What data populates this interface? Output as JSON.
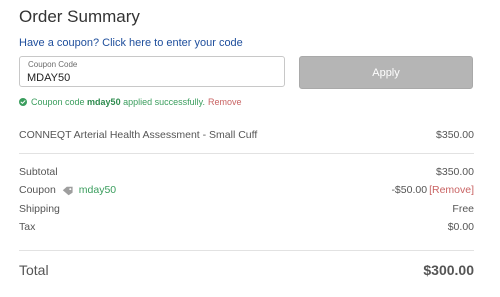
{
  "summary": {
    "title": "Order Summary",
    "coupon_link": "Have a coupon? Click here to enter your code"
  },
  "coupon_form": {
    "label": "Coupon Code",
    "value": "MDAY50",
    "apply_label": "Apply"
  },
  "coupon_status": {
    "prefix": "Coupon code ",
    "code": "mday50",
    "suffix": " applied successfully.",
    "remove_label": "Remove"
  },
  "line_item": {
    "name": "CONNEQT Arterial Health Assessment - Small Cuff",
    "price": "$350.00"
  },
  "totals": {
    "subtotal_label": "Subtotal",
    "subtotal_value": "$350.00",
    "coupon_label": "Coupon",
    "coupon_code": "mday50",
    "coupon_discount": "-$50.00",
    "coupon_remove": "[Remove]",
    "shipping_label": "Shipping",
    "shipping_value": "Free",
    "tax_label": "Tax",
    "tax_value": "$0.00",
    "total_label": "Total",
    "total_value": "$300.00"
  },
  "colors": {
    "link": "#1e4e9c",
    "success": "#3a9d5d",
    "remove": "#c96363",
    "apply_button": "#b5b5b5"
  },
  "icons": [
    "check-circle-icon",
    "tag-icon"
  ]
}
